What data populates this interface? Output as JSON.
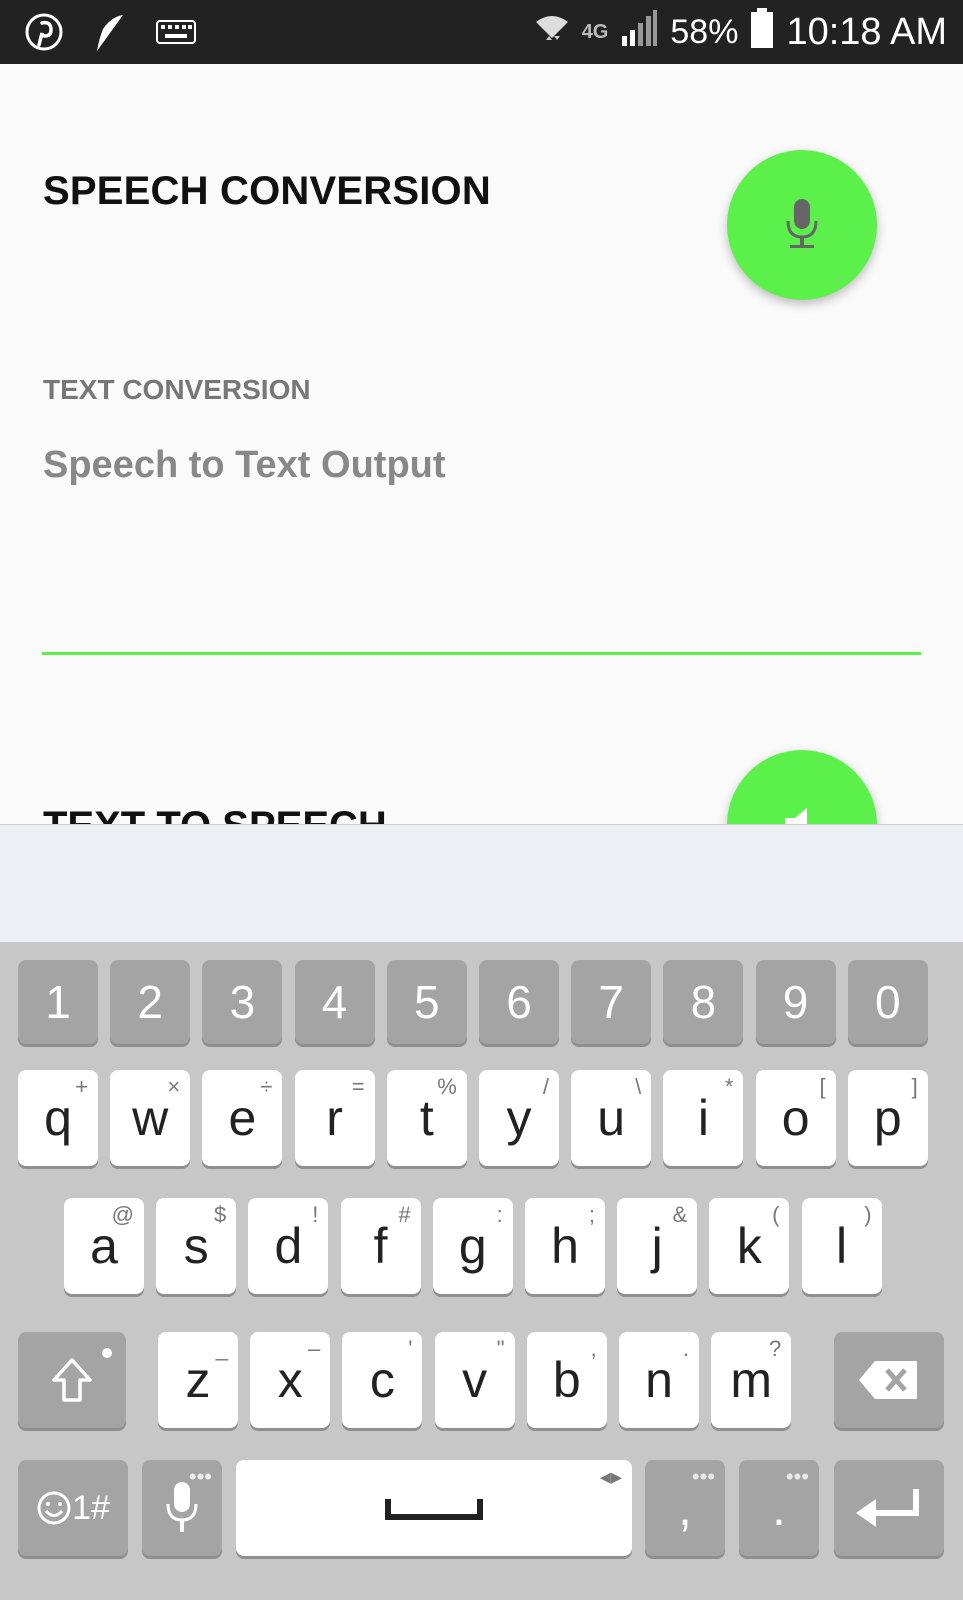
{
  "status_bar": {
    "network": "4G",
    "battery": "58%",
    "time": "10:18 AM"
  },
  "app": {
    "title": "SPEECH CONVERSION",
    "section_label": "TEXT CONVERSION",
    "output_placeholder": "Speech to Text Output",
    "second_title": "TEXT TO SPEECH",
    "accent_color": "#5cf14a"
  },
  "keyboard": {
    "number_row": [
      "1",
      "2",
      "3",
      "4",
      "5",
      "6",
      "7",
      "8",
      "9",
      "0"
    ],
    "row1": [
      {
        "k": "q",
        "s": "+"
      },
      {
        "k": "w",
        "s": "×"
      },
      {
        "k": "e",
        "s": "÷"
      },
      {
        "k": "r",
        "s": "="
      },
      {
        "k": "t",
        "s": "%"
      },
      {
        "k": "y",
        "s": "/"
      },
      {
        "k": "u",
        "s": "\\"
      },
      {
        "k": "i",
        "s": "*"
      },
      {
        "k": "o",
        "s": "["
      },
      {
        "k": "p",
        "s": "]"
      }
    ],
    "row2": [
      {
        "k": "a",
        "s": "@"
      },
      {
        "k": "s",
        "s": "$"
      },
      {
        "k": "d",
        "s": "!"
      },
      {
        "k": "f",
        "s": "#"
      },
      {
        "k": "g",
        "s": ":"
      },
      {
        "k": "h",
        "s": ";"
      },
      {
        "k": "j",
        "s": "&"
      },
      {
        "k": "k",
        "s": "("
      },
      {
        "k": "l",
        "s": ")"
      }
    ],
    "row3": [
      {
        "k": "z",
        "s": "_"
      },
      {
        "k": "x",
        "s": "–"
      },
      {
        "k": "c",
        "s": "'"
      },
      {
        "k": "v",
        "s": "\""
      },
      {
        "k": "b",
        "s": ","
      },
      {
        "k": "n",
        "s": "."
      },
      {
        "k": "m",
        "s": "?"
      }
    ],
    "symbols_label": "1#",
    "comma": ",",
    "period": "."
  }
}
